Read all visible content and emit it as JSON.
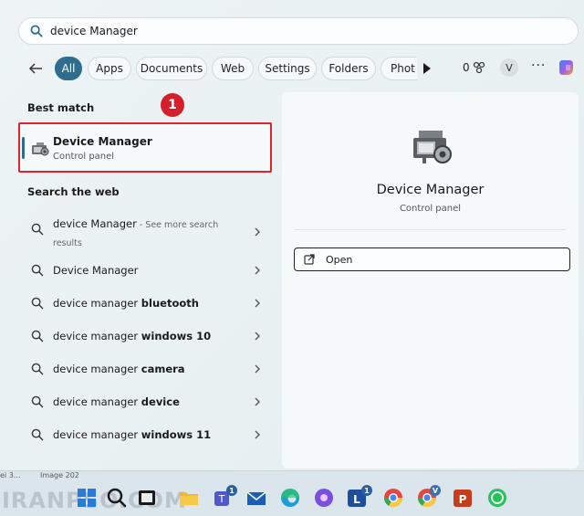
{
  "search": {
    "value": "device Manager"
  },
  "filters": {
    "chips": [
      "All",
      "Apps",
      "Documents",
      "Web",
      "Settings",
      "Folders",
      "Phot"
    ],
    "reward_count": "0",
    "avatar_letter": "V",
    "more": "···"
  },
  "best_match": {
    "title": "Best match",
    "app_name": "Device Manager",
    "app_type": "Control panel",
    "annotation_number": "1"
  },
  "web": {
    "title": "Search the web",
    "first": {
      "query": "device Manager",
      "hint": " - See more search results"
    },
    "items": [
      {
        "prefix": "Device Manager",
        "bold": ""
      },
      {
        "prefix": "device manager ",
        "bold": "bluetooth"
      },
      {
        "prefix": "device manager ",
        "bold": "windows 10"
      },
      {
        "prefix": "device manager ",
        "bold": "camera"
      },
      {
        "prefix": "device manager ",
        "bold": "device"
      },
      {
        "prefix": "device manager ",
        "bold": "windows 11"
      }
    ]
  },
  "preview": {
    "title": "Device Manager",
    "subtitle": "Control panel",
    "open_label": "Open"
  },
  "taskbar": {
    "strip_left": "ei 3...",
    "strip_right": "Image 202",
    "watermark": "IRANPSO.COM",
    "badges": {
      "teams": "1",
      "word": "1",
      "chrome2": "V"
    }
  },
  "colors": {
    "accent": "#2f6d8e",
    "highlight": "#d9262c"
  }
}
